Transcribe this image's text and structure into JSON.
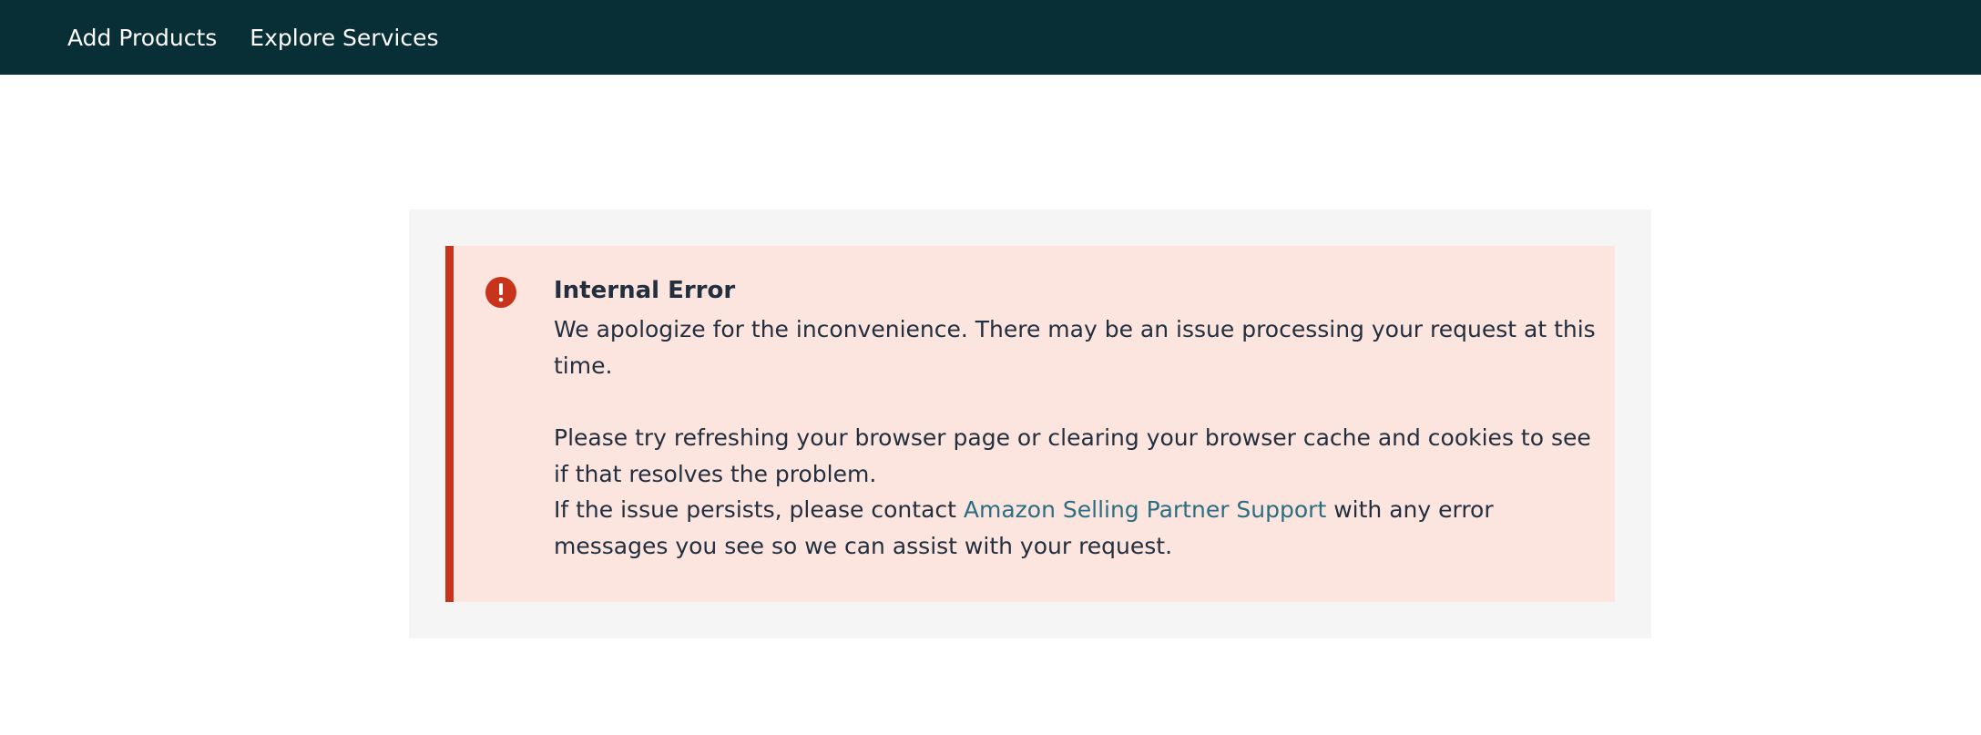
{
  "nav": {
    "items": [
      {
        "label": "Add Products"
      },
      {
        "label": "Explore Services"
      }
    ]
  },
  "alert": {
    "icon": "exclamation-circle-icon",
    "title": "Internal Error",
    "message_1": "We apologize for the inconvenience. There may be an issue processing your request at this time.",
    "message_2": "Please try refreshing your browser page or clearing your browser cache and cookies to see if that resolves the problem.",
    "message_3_before": "If the issue persists, please contact ",
    "support_link_label": "Amazon Selling Partner Support",
    "message_3_after": " with any error messages you see so we can assist with your request."
  },
  "colors": {
    "topbar": "#082e36",
    "alert_background": "#fce5df",
    "alert_border": "#c8331c",
    "link": "#2c6e80",
    "outer_panel": "#f5f5f5"
  }
}
